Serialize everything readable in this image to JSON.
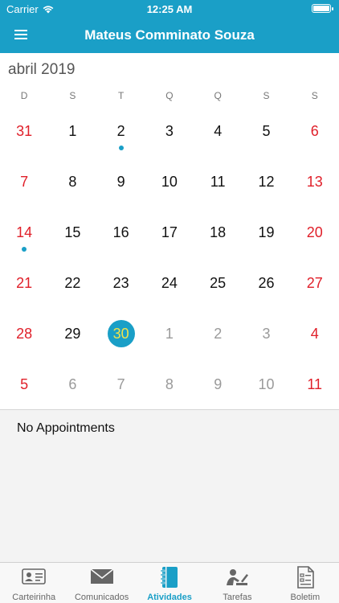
{
  "status_bar": {
    "carrier": "Carrier",
    "time": "12:25 AM"
  },
  "header": {
    "title": "Mateus Comminato Souza",
    "menu_icon": "hamburger-menu-icon"
  },
  "calendar": {
    "month_label": "abril 2019",
    "weekdays": [
      "D",
      "S",
      "T",
      "Q",
      "Q",
      "S",
      "S"
    ],
    "weeks": [
      [
        {
          "day": "31",
          "other": false,
          "weekend": true
        },
        {
          "day": "1",
          "other": false,
          "weekend": false
        },
        {
          "day": "2",
          "other": false,
          "weekend": false,
          "event": true
        },
        {
          "day": "3",
          "other": false,
          "weekend": false
        },
        {
          "day": "4",
          "other": false,
          "weekend": false
        },
        {
          "day": "5",
          "other": false,
          "weekend": false
        },
        {
          "day": "6",
          "other": false,
          "weekend": true
        }
      ],
      [
        {
          "day": "7",
          "other": false,
          "weekend": true
        },
        {
          "day": "8",
          "other": false,
          "weekend": false
        },
        {
          "day": "9",
          "other": false,
          "weekend": false
        },
        {
          "day": "10",
          "other": false,
          "weekend": false
        },
        {
          "day": "11",
          "other": false,
          "weekend": false
        },
        {
          "day": "12",
          "other": false,
          "weekend": false
        },
        {
          "day": "13",
          "other": false,
          "weekend": true
        }
      ],
      [
        {
          "day": "14",
          "other": false,
          "weekend": true,
          "event": true
        },
        {
          "day": "15",
          "other": false,
          "weekend": false
        },
        {
          "day": "16",
          "other": false,
          "weekend": false
        },
        {
          "day": "17",
          "other": false,
          "weekend": false
        },
        {
          "day": "18",
          "other": false,
          "weekend": false
        },
        {
          "day": "19",
          "other": false,
          "weekend": false
        },
        {
          "day": "20",
          "other": false,
          "weekend": true
        }
      ],
      [
        {
          "day": "21",
          "other": false,
          "weekend": true
        },
        {
          "day": "22",
          "other": false,
          "weekend": false
        },
        {
          "day": "23",
          "other": false,
          "weekend": false
        },
        {
          "day": "24",
          "other": false,
          "weekend": false
        },
        {
          "day": "25",
          "other": false,
          "weekend": false
        },
        {
          "day": "26",
          "other": false,
          "weekend": false
        },
        {
          "day": "27",
          "other": false,
          "weekend": true
        }
      ],
      [
        {
          "day": "28",
          "other": false,
          "weekend": true
        },
        {
          "day": "29",
          "other": false,
          "weekend": false
        },
        {
          "day": "30",
          "other": false,
          "weekend": false,
          "selected": true
        },
        {
          "day": "1",
          "other": true,
          "weekend": false
        },
        {
          "day": "2",
          "other": true,
          "weekend": false
        },
        {
          "day": "3",
          "other": true,
          "weekend": false
        },
        {
          "day": "4",
          "other": true,
          "weekend": true
        }
      ],
      [
        {
          "day": "5",
          "other": true,
          "weekend": true
        },
        {
          "day": "6",
          "other": true,
          "weekend": false
        },
        {
          "day": "7",
          "other": true,
          "weekend": false
        },
        {
          "day": "8",
          "other": true,
          "weekend": false
        },
        {
          "day": "9",
          "other": true,
          "weekend": false
        },
        {
          "day": "10",
          "other": true,
          "weekend": false
        },
        {
          "day": "11",
          "other": true,
          "weekend": true
        }
      ]
    ]
  },
  "appointments": {
    "empty_text": "No Appointments"
  },
  "tabs": [
    {
      "label": "Carteirinha",
      "icon": "id-card-icon",
      "active": false
    },
    {
      "label": "Comunicados",
      "icon": "envelope-icon",
      "active": false
    },
    {
      "label": "Atividades",
      "icon": "notebook-icon",
      "active": true
    },
    {
      "label": "Tarefas",
      "icon": "student-writing-icon",
      "active": false
    },
    {
      "label": "Boletim",
      "icon": "report-card-icon",
      "active": false
    }
  ],
  "colors": {
    "accent": "#1a9fc7",
    "weekend": "#e0202a",
    "selected_text": "#f1e34a"
  }
}
